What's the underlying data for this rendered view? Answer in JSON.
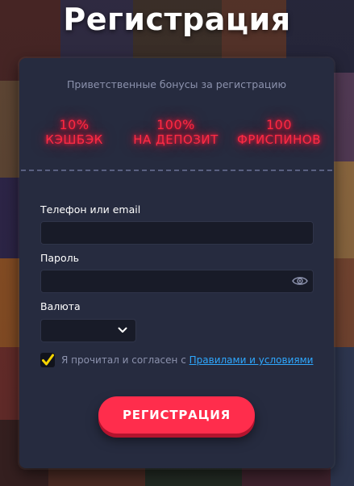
{
  "page": {
    "title": "Регистрация"
  },
  "bonus_section": {
    "title": "Приветственные бонусы за регистрацию",
    "items": [
      {
        "value": "10%",
        "label": "КЭШБЭК"
      },
      {
        "value": "100%",
        "label": "НА ДЕПОЗИТ"
      },
      {
        "value": "100",
        "label": "ФРИСПИНОВ"
      }
    ]
  },
  "form": {
    "login": {
      "label": "Телефон или email",
      "value": "",
      "placeholder": ""
    },
    "password": {
      "label": "Пароль",
      "value": "",
      "placeholder": ""
    },
    "currency": {
      "label": "Валюта",
      "selected": ""
    },
    "terms": {
      "checked": true,
      "text": "Я прочитал и согласен с",
      "link_text": "Правилами и условиями"
    },
    "submit_label": "РЕГИСТРАЦИЯ"
  },
  "icons": {
    "password_toggle": "eye-icon",
    "currency_dropdown": "chevron-down-icon",
    "terms_check": "checkmark-icon"
  },
  "colors": {
    "card_bg": "#262b3f",
    "neon_red": "#ff2b45",
    "button": "#ff2d4c",
    "link": "#2ea8ff",
    "checkmark": "#f5d400"
  }
}
